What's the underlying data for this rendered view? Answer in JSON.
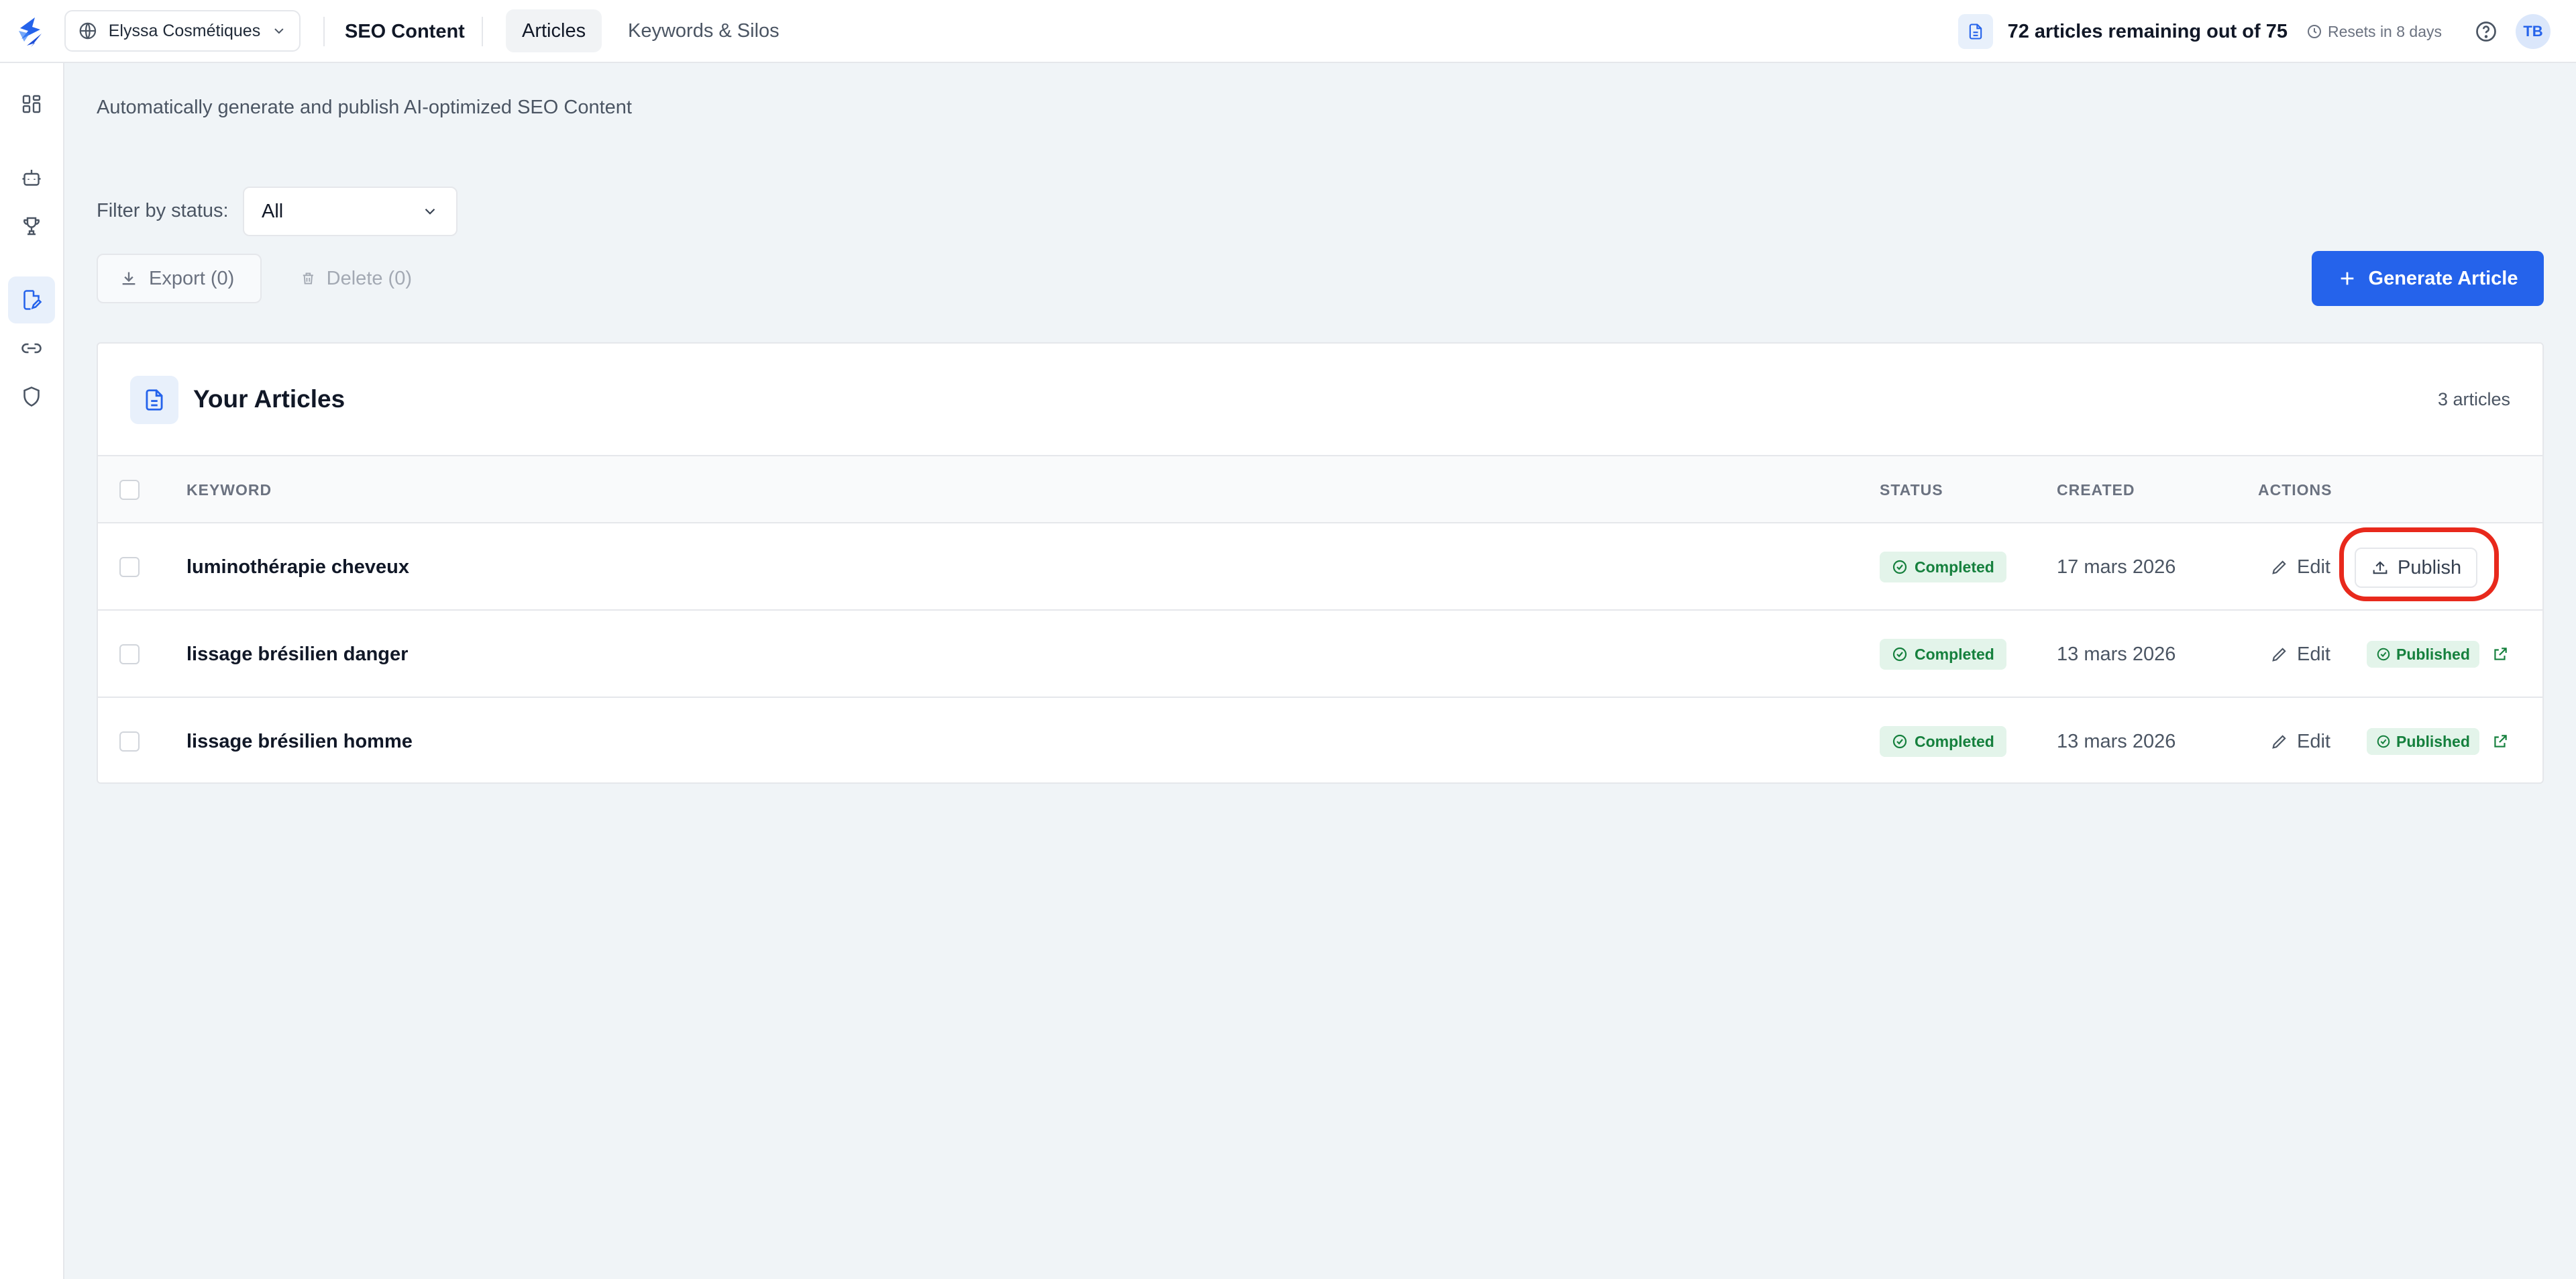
{
  "topbar": {
    "org_name": "Elyssa Cosmétiques",
    "section_title": "SEO Content",
    "tabs": [
      {
        "label": "Articles",
        "active": true
      },
      {
        "label": "Keywords & Silos",
        "active": false
      }
    ],
    "quota_text": "72 articles remaining out of 75",
    "resets_text": "Resets in 8 days",
    "avatar_initials": "TB"
  },
  "sidebar": {
    "items": [
      {
        "icon": "dashboard-icon",
        "active": false
      },
      {
        "icon": "robot-icon",
        "active": false
      },
      {
        "icon": "trophy-icon",
        "active": false
      },
      {
        "icon": "article-edit-icon",
        "active": true
      },
      {
        "icon": "link-icon",
        "active": false
      },
      {
        "icon": "shield-icon",
        "active": false
      }
    ]
  },
  "main": {
    "subtitle": "Automatically generate and publish AI-optimized SEO Content",
    "filter_label": "Filter by status:",
    "filter_value": "All",
    "export_label": "Export (0)",
    "delete_label": "Delete (0)",
    "generate_label": "Generate Article"
  },
  "card": {
    "title": "Your Articles",
    "count": "3 articles",
    "columns": {
      "keyword": "KEYWORD",
      "status": "STATUS",
      "created": "CREATED",
      "actions": "ACTIONS"
    },
    "rows": [
      {
        "keyword": "luminothérapie cheveux",
        "status": "Completed",
        "created": "17 mars 2026",
        "edit": "Edit",
        "action": "Publish",
        "published": false
      },
      {
        "keyword": "lissage brésilien danger",
        "status": "Completed",
        "created": "13 mars 2026",
        "edit": "Edit",
        "action": "Published",
        "published": true
      },
      {
        "keyword": "lissage brésilien homme",
        "status": "Completed",
        "created": "13 mars 2026",
        "edit": "Edit",
        "action": "Published",
        "published": true
      }
    ]
  },
  "colors": {
    "accent": "#2563eb",
    "success": "#15803d",
    "highlight": "#e8291c"
  }
}
